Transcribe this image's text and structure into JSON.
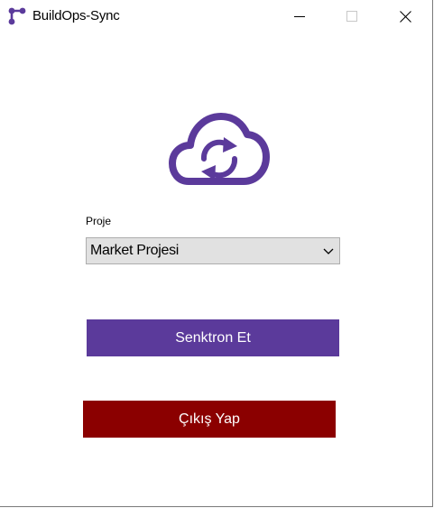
{
  "window": {
    "title": "BuildOps-Sync"
  },
  "icons": {
    "app": "app-logo-icon",
    "minimize": "minimize-icon",
    "maximize": "maximize-icon",
    "close": "close-icon",
    "cloud_sync": "cloud-sync-icon",
    "dropdown": "chevron-down-icon"
  },
  "form": {
    "project_label": "Proje",
    "project_value": "Market Projesi"
  },
  "actions": {
    "sync_label": "Senktron Et",
    "exit_label": "Çıkış Yap"
  },
  "colors": {
    "brand_purple": "#5b3a9b",
    "exit_red": "#8b0000",
    "combo_bg": "#e1e1e1"
  }
}
